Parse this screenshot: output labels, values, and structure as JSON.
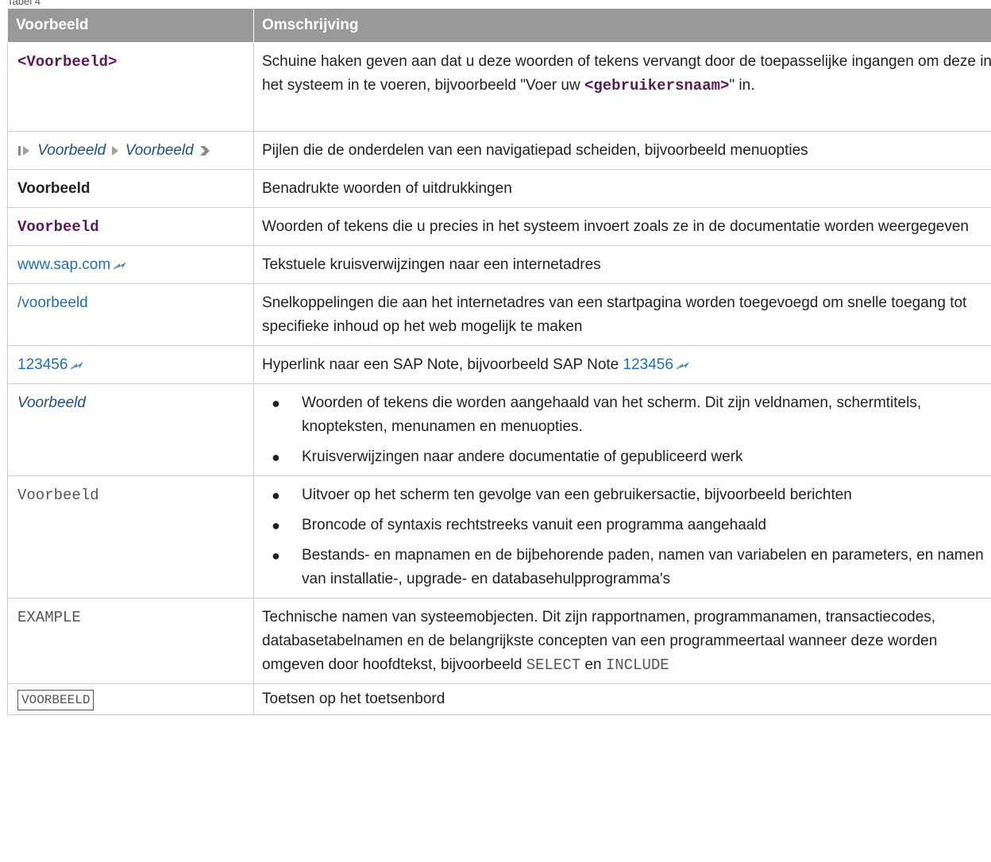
{
  "caption": "Tabel 4",
  "headers": {
    "col1": "Voorbeeld",
    "col2": "Omschrijving"
  },
  "rows": {
    "r1": {
      "example": "<Voorbeeld>",
      "desc_part1": "Schuine haken geven aan dat u deze woorden of tekens vervangt door de toepasselijke ingangen om deze in het systeem in te voeren, bijvoorbeeld \"Voer uw ",
      "desc_code": "<gebruikersnaam>",
      "desc_part2": "\" in."
    },
    "r2": {
      "nav_item1": "Voorbeeld",
      "nav_item2": "Voorbeeld",
      "desc": "Pijlen die de onderdelen van een navigatiepad scheiden, bijvoorbeeld menuopties"
    },
    "r3": {
      "example": "Voorbeeld",
      "desc": "Benadrukte woorden of uitdrukkingen"
    },
    "r4": {
      "example": "Voorbeeld",
      "desc": "Woorden of tekens die u precies in het systeem invoert zoals ze in de documentatie worden weergegeven"
    },
    "r5": {
      "example": "www.sap.com",
      "desc": "Tekstuele kruisverwijzingen naar een internetadres"
    },
    "r6": {
      "example": "/voorbeeld",
      "desc": "Snelkoppelingen die aan het internetadres van een startpagina worden toegevoegd om snelle toegang tot specifieke inhoud op het web mogelijk te maken"
    },
    "r7": {
      "example": "123456",
      "desc_text": "Hyperlink naar een SAP Note, bijvoorbeeld SAP Note ",
      "desc_link": "123456"
    },
    "r8": {
      "example": "Voorbeeld",
      "bullets": [
        "Woorden of tekens die worden aangehaald van het scherm. Dit zijn veldnamen, schermtitels, knopteksten, menunamen en menuopties.",
        "Kruisverwijzingen naar andere documentatie of gepubliceerd werk"
      ]
    },
    "r9": {
      "example": "Voorbeeld",
      "bullets": [
        "Uitvoer op het scherm ten gevolge van een gebruikersactie, bijvoorbeeld berichten",
        "Broncode of syntaxis rechtstreeks vanuit een programma aangehaald",
        "Bestands- en mapnamen en de bijbehorende paden, namen van variabelen en parameters, en namen van installatie-, upgrade- en databasehulpprogramma's"
      ]
    },
    "r10": {
      "example": "EXAMPLE",
      "desc_part1": "Technische namen van systeemobjecten. Dit zijn rapportnamen, programmanamen, transactiecodes, databasetabelnamen en de belangrijkste concepten van een programmeertaal wanneer deze worden omgeven door hoofdtekst, bijvoorbeeld ",
      "desc_code1": "SELECT",
      "desc_mid": " en ",
      "desc_code2": "INCLUDE"
    },
    "r11": {
      "example": "VOORBEELD",
      "desc": "Toetsen op het toetsenbord"
    }
  },
  "icons": {
    "nav_start": "nav-start-arrow-icon",
    "nav_sep": "nav-separator-arrow-icon",
    "nav_end": "nav-end-arrow-icon",
    "external_link": "external-link-icon"
  },
  "colors": {
    "header_bg": "#999999",
    "link": "#1f6fb5",
    "code_purple": "#5a1a5a"
  }
}
